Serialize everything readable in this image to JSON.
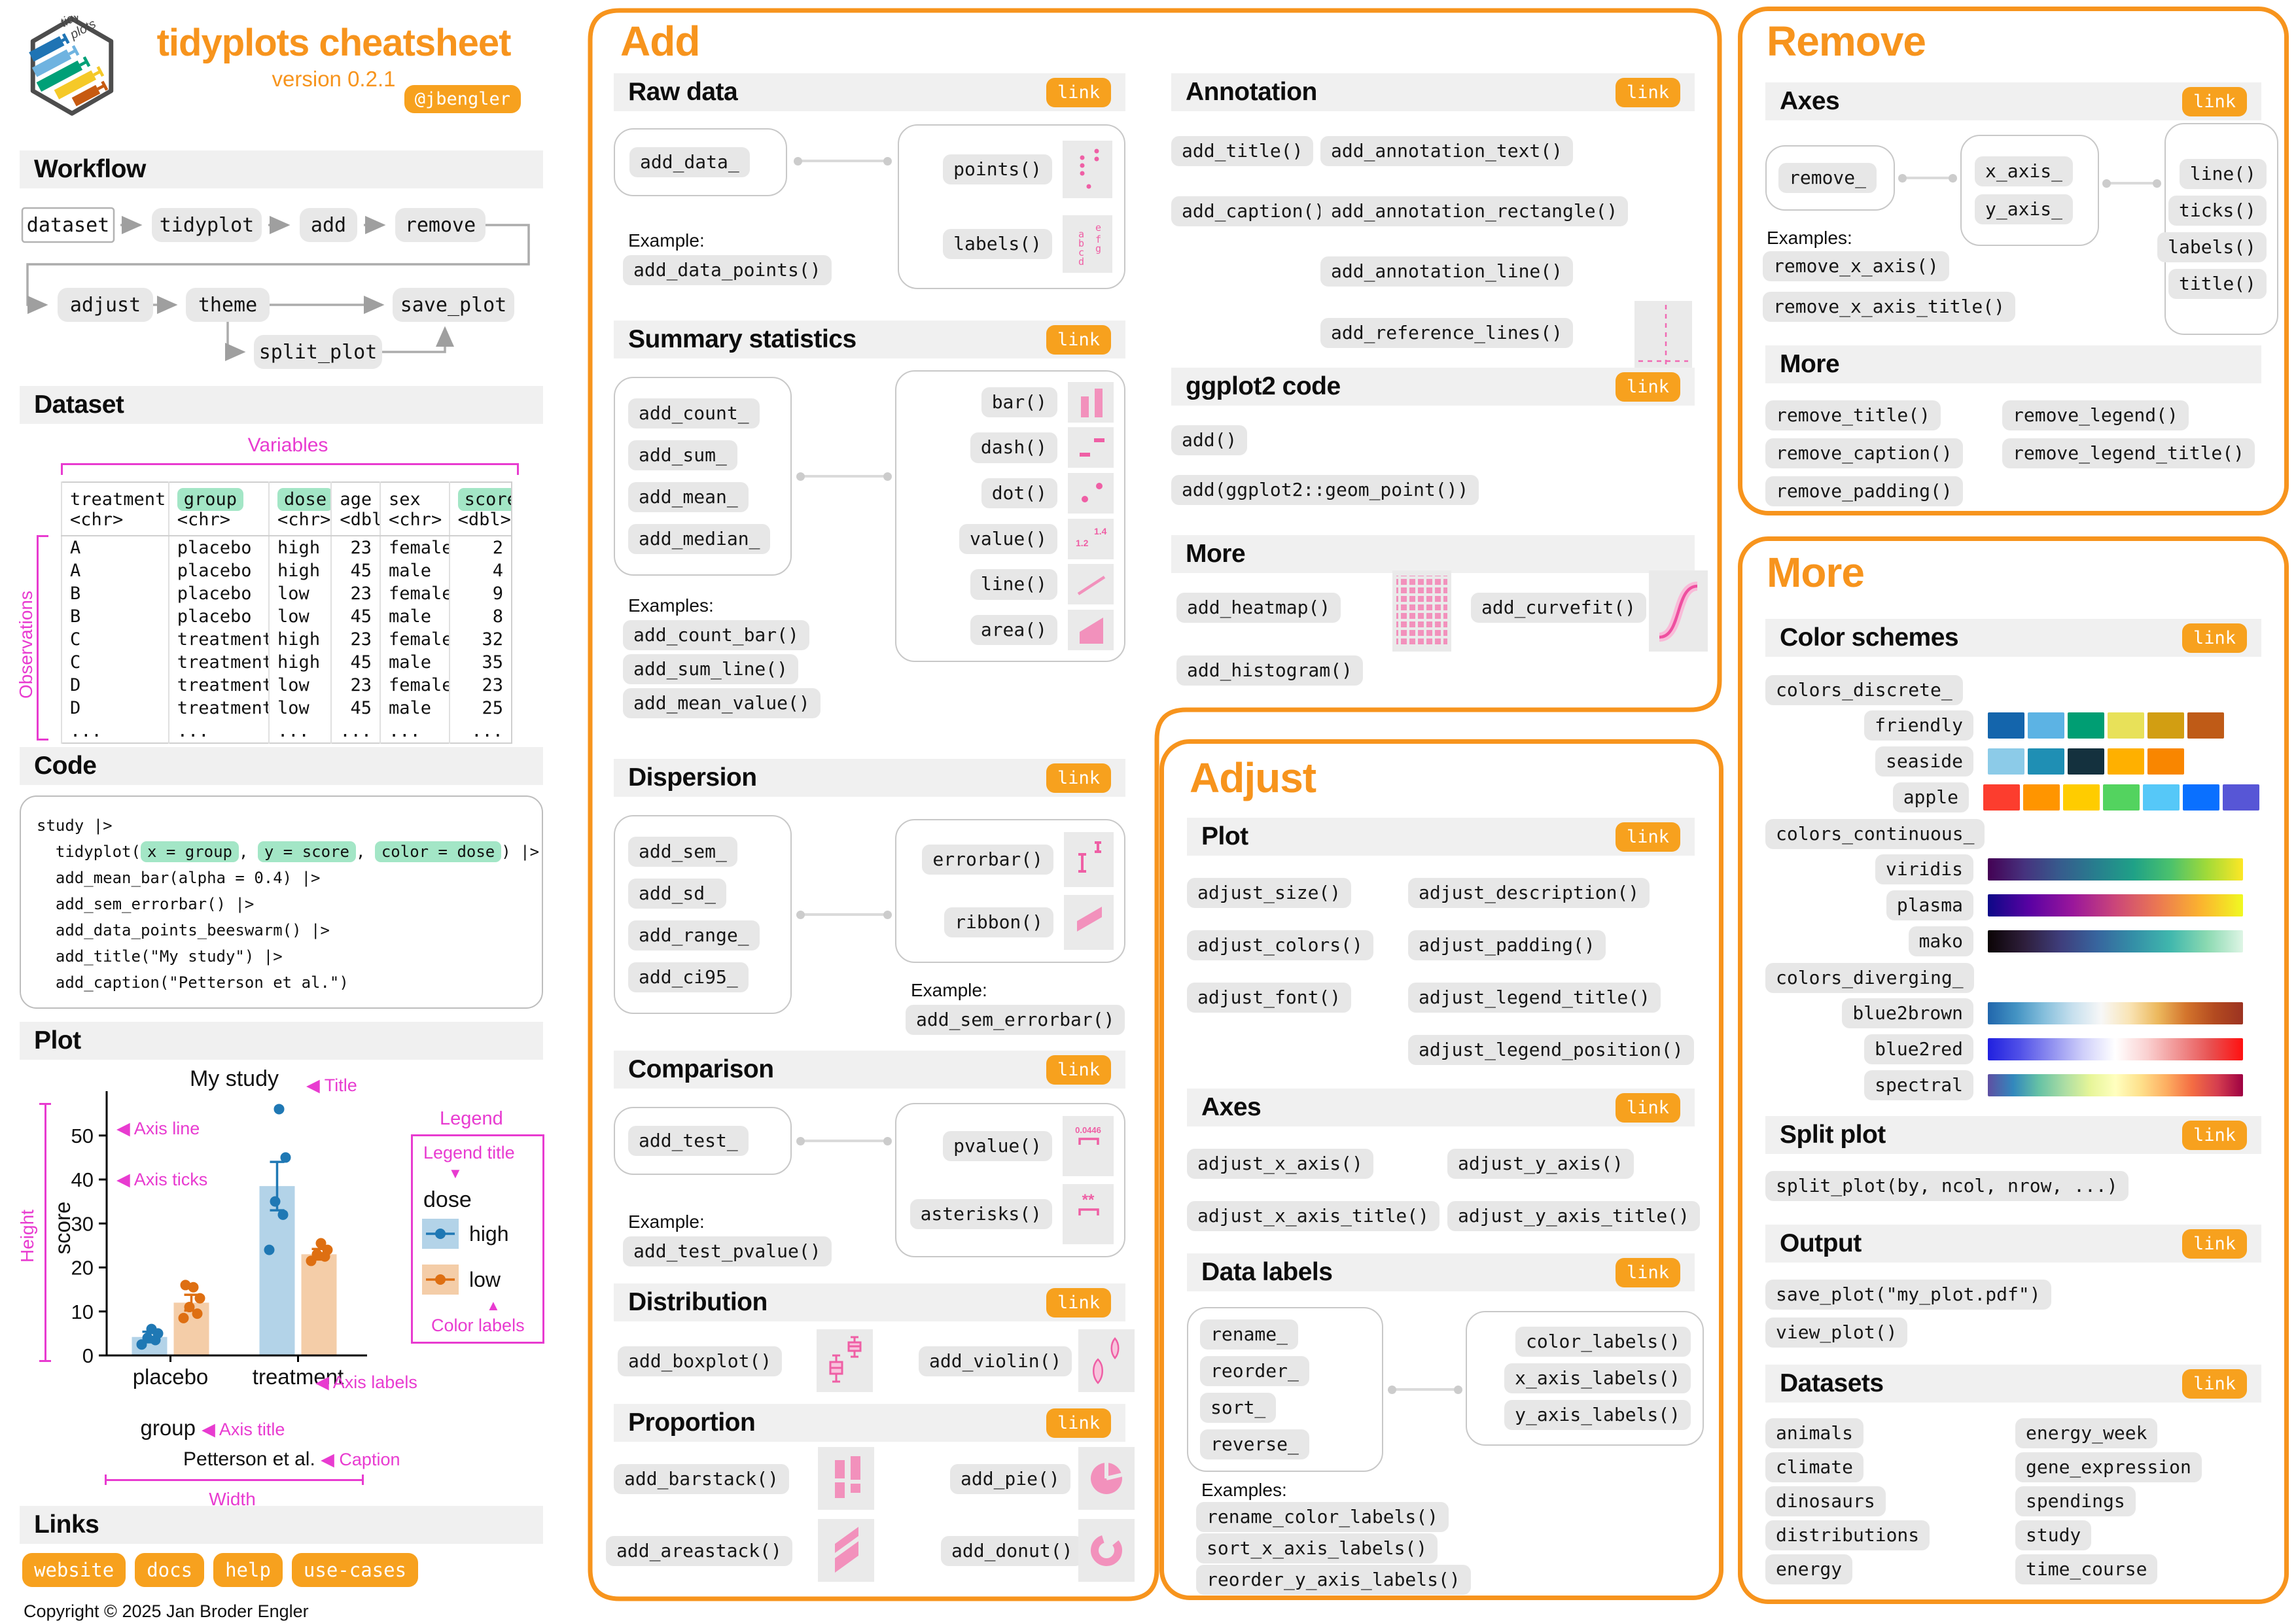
{
  "meta": {
    "title": "tidyplots cheatsheet",
    "version": "version 0.2.1",
    "handle": "@jbengler",
    "copyright": "Copyright © 2025 Jan Broder Engler",
    "link_label": "link",
    "logo_text1": "tidy",
    "logo_text2": "plots"
  },
  "colors": {
    "accent": "#F7941D",
    "magenta": "#E83BD0",
    "green_highlight": "#A3E6C6",
    "pink": "#F291BC"
  },
  "left": {
    "workflow": {
      "title": "Workflow",
      "nodes": [
        "dataset",
        "tidyplot",
        "add",
        "remove",
        "adjust",
        "theme",
        "save_plot",
        "split_plot"
      ]
    },
    "dataset": {
      "title": "Dataset",
      "variables": "Variables",
      "observations": "Observations",
      "columns": [
        {
          "n": "treatment",
          "t": "<chr>"
        },
        {
          "n": "group",
          "t": "<chr>",
          "hl": true
        },
        {
          "n": "dose",
          "t": "<chr>",
          "hl": true
        },
        {
          "n": "age",
          "t": "<dbl>",
          "num": true
        },
        {
          "n": "sex",
          "t": "<chr>"
        },
        {
          "n": "score",
          "t": "<dbl>",
          "hl": true,
          "num": true
        }
      ],
      "rows": [
        [
          "A",
          "placebo",
          "high",
          "23",
          "female",
          "2"
        ],
        [
          "A",
          "placebo",
          "high",
          "45",
          "male",
          "4"
        ],
        [
          "B",
          "placebo",
          "low",
          "23",
          "female",
          "9"
        ],
        [
          "B",
          "placebo",
          "low",
          "45",
          "male",
          "8"
        ],
        [
          "C",
          "treatment",
          "high",
          "23",
          "female",
          "32"
        ],
        [
          "C",
          "treatment",
          "high",
          "45",
          "male",
          "35"
        ],
        [
          "D",
          "treatment",
          "low",
          "23",
          "female",
          "23"
        ],
        [
          "D",
          "treatment",
          "low",
          "45",
          "male",
          "25"
        ],
        [
          "...",
          "...",
          "...",
          "...",
          "...",
          "..."
        ]
      ]
    },
    "code": {
      "title": "Code",
      "lines": [
        [
          {
            "t": "study |>"
          }
        ],
        [
          {
            "t": "  tidyplot("
          },
          {
            "t": "x = group",
            "hl": true
          },
          {
            "t": ", "
          },
          {
            "t": "y = score",
            "hl": true
          },
          {
            "t": ", "
          },
          {
            "t": "color = dose",
            "hl": true
          },
          {
            "t": ") |>"
          }
        ],
        [
          {
            "t": "  add_mean_bar(alpha = 0.4) |>"
          }
        ],
        [
          {
            "t": "  add_sem_errorbar() |>"
          }
        ],
        [
          {
            "t": "  add_data_points_beeswarm() |>"
          }
        ],
        [
          {
            "t": "  add_title(\"My study\") |>"
          }
        ],
        [
          {
            "t": "  add_caption(\"Petterson et al.\")"
          }
        ]
      ]
    },
    "plot": {
      "title": "Plot",
      "an": {
        "title_note": "Title",
        "axis_line": "Axis line",
        "axis_ticks": "Axis ticks",
        "height": "Height",
        "width": "Width",
        "legend": "Legend",
        "legend_title": "Legend title",
        "color_labels": "Color labels",
        "axis_labels": "Axis labels",
        "axis_title": "Axis title",
        "caption_note": "Caption"
      },
      "legend": {
        "entries": [
          "high",
          "low"
        ]
      }
    },
    "links": {
      "title": "Links",
      "items": [
        "website",
        "docs",
        "help",
        "use-cases"
      ]
    }
  },
  "chart_data": {
    "type": "bar",
    "title": "My study",
    "xlabel": "group",
    "ylabel": "score",
    "caption": "Petterson et al.",
    "categories": [
      "placebo",
      "treatment"
    ],
    "yticks": [
      0,
      10,
      20,
      30,
      40,
      50
    ],
    "ylim": [
      0,
      58
    ],
    "legend_title": "dose",
    "legend_position": "right",
    "grid": false,
    "series": [
      {
        "name": "high",
        "color": "#1F78B4",
        "bar_color": "#B3D3E8",
        "values": [
          4.2,
          38.5
        ],
        "sem": [
          1.2,
          5.5
        ],
        "points": [
          [
            2.5,
            3.5,
            4,
            5,
            6
          ],
          [
            24,
            32,
            35,
            45,
            56
          ]
        ]
      },
      {
        "name": "low",
        "color": "#DE6F12",
        "bar_color": "#F4CDA8",
        "values": [
          12,
          23
        ],
        "sem": [
          1.8,
          1.2
        ],
        "points": [
          [
            8.5,
            9.5,
            11,
            13,
            15.5,
            16
          ],
          [
            21.5,
            22.5,
            23,
            24,
            25.5
          ]
        ]
      }
    ]
  },
  "add": {
    "title": "Add",
    "sections": {
      "raw": {
        "title": "Raw data",
        "source": "add_data_",
        "targets": [
          "points()",
          "labels()"
        ],
        "example_label": "Example:",
        "example": "add_data_points()"
      },
      "summary": {
        "title": "Summary statistics",
        "sources": [
          "add_count_",
          "add_sum_",
          "add_mean_",
          "add_median_"
        ],
        "targets": [
          "bar()",
          "dash()",
          "dot()",
          "value()",
          "line()",
          "area()"
        ],
        "examples_label": "Examples:",
        "examples": [
          "add_count_bar()",
          "add_sum_line()",
          "add_mean_value()"
        ]
      },
      "dispersion": {
        "title": "Dispersion",
        "sources": [
          "add_sem_",
          "add_sd_",
          "add_range_",
          "add_ci95_"
        ],
        "targets": [
          "errorbar()",
          "ribbon()"
        ],
        "example_label": "Example:",
        "example": "add_sem_errorbar()"
      },
      "comparison": {
        "title": "Comparison",
        "source": "add_test_",
        "targets": [
          "pvalue()",
          "asterisks()"
        ],
        "example_label": "Example:",
        "example": "add_test_pvalue()",
        "pvalue_icon_text": "0.0446",
        "asterisks_icon_text": "**"
      },
      "distribution": {
        "title": "Distribution",
        "items": [
          "add_boxplot()",
          "add_violin()"
        ]
      },
      "proportion": {
        "title": "Proportion",
        "items": [
          "add_barstack()",
          "add_pie()",
          "add_areastack()",
          "add_donut()"
        ]
      },
      "annotation": {
        "title": "Annotation",
        "pills": [
          "add_title()",
          "add_annotation_text()",
          "add_caption()",
          "add_annotation_rectangle()",
          "add_annotation_line()",
          "add_reference_lines()"
        ]
      },
      "ggplot2": {
        "title": "ggplot2 code",
        "pills": [
          "add()",
          "add(ggplot2::geom_point())"
        ]
      },
      "more": {
        "title": "More",
        "pills": [
          "add_heatmap()",
          "add_curvefit()",
          "add_histogram()"
        ]
      }
    }
  },
  "adjust": {
    "title": "Adjust",
    "plot": {
      "title": "Plot",
      "col1": [
        "adjust_size()",
        "adjust_colors()",
        "adjust_font()"
      ],
      "col2": [
        "adjust_description()",
        "adjust_padding()",
        "adjust_legend_title()",
        "adjust_legend_position()"
      ]
    },
    "axes": {
      "title": "Axes",
      "col1": [
        "adjust_x_axis()",
        "adjust_x_axis_title()"
      ],
      "col2": [
        "adjust_y_axis()",
        "adjust_y_axis_title()"
      ]
    },
    "datalabels": {
      "title": "Data labels",
      "sources": [
        "rename_",
        "reorder_",
        "sort_",
        "reverse_"
      ],
      "targets": [
        "color_labels()",
        "x_axis_labels()",
        "y_axis_labels()"
      ],
      "examples_label": "Examples:",
      "examples": [
        "rename_color_labels()",
        "sort_x_axis_labels()",
        "reorder_y_axis_labels()"
      ]
    }
  },
  "remove": {
    "title": "Remove",
    "axes": {
      "title": "Axes",
      "source": "remove_",
      "mid": [
        "x_axis_",
        "y_axis_"
      ],
      "targets": [
        "line()",
        "ticks()",
        "labels()",
        "title()"
      ],
      "examples_label": "Examples:",
      "examples": [
        "remove_x_axis()",
        "remove_x_axis_title()"
      ]
    },
    "more": {
      "title": "More",
      "col1": [
        "remove_title()",
        "remove_caption()",
        "remove_padding()"
      ],
      "col2": [
        "remove_legend()",
        "remove_legend_title()"
      ]
    }
  },
  "more_panel": {
    "title": "More",
    "colors": {
      "title": "Color schemes",
      "discrete_label": "colors_discrete_",
      "continuous_label": "colors_continuous_",
      "diverging_label": "colors_diverging_",
      "discrete": [
        {
          "label": "friendly",
          "colors": [
            "#1465AC",
            "#5CB3E4",
            "#009E73",
            "#E8E159",
            "#D29E12",
            "#BF5B17"
          ]
        },
        {
          "label": "seaside",
          "colors": [
            "#8CCBE8",
            "#1F8FB4",
            "#14313E",
            "#FFB000",
            "#F98600"
          ]
        },
        {
          "label": "apple",
          "colors": [
            "#FC3D2E",
            "#FF9500",
            "#FFCC00",
            "#53D35F",
            "#56C8F8",
            "#0A70FF",
            "#5756D6"
          ]
        }
      ],
      "continuous": [
        {
          "label": "viridis",
          "colors": [
            "#440154",
            "#46327E",
            "#365C8D",
            "#277F8E",
            "#1FA187",
            "#4AC16D",
            "#A0DA39",
            "#FDE725"
          ]
        },
        {
          "label": "plasma",
          "colors": [
            "#0D0887",
            "#5B02A3",
            "#9A179B",
            "#CB4679",
            "#EB7852",
            "#FBB32F",
            "#F0F921"
          ]
        },
        {
          "label": "mako",
          "colors": [
            "#0B0405",
            "#2E1E3B",
            "#3F3E7C",
            "#37659E",
            "#348FA7",
            "#40B7AD",
            "#8AD9B1",
            "#DEF5E5"
          ]
        }
      ],
      "diverging": [
        {
          "label": "blue2brown",
          "colors": [
            "#2166AC",
            "#4393C3",
            "#86BFDC",
            "#C7E0EE",
            "#F7F7F7",
            "#F9E4B5",
            "#ECB85D",
            "#D3742C",
            "#B34A20",
            "#9C3321"
          ]
        },
        {
          "label": "blue2red",
          "colors": [
            "#2020DF",
            "#5050E8",
            "#9090F0",
            "#D0D0FA",
            "#FFFFFF",
            "#FAD0D0",
            "#F09090",
            "#E85050",
            "#FF1010"
          ]
        },
        {
          "label": "spectral",
          "colors": [
            "#5E4FA2",
            "#3288BD",
            "#66C2A5",
            "#ABDDA4",
            "#E6F598",
            "#FFFFBF",
            "#FEE08B",
            "#FDAE61",
            "#F46D43",
            "#D53E4F",
            "#9E0142"
          ]
        }
      ]
    },
    "split": {
      "title": "Split plot",
      "pill": "split_plot(by, ncol, nrow, ...)"
    },
    "output": {
      "title": "Output",
      "pills": [
        "save_plot(\"my_plot.pdf\")",
        "view_plot()"
      ]
    },
    "datasets": {
      "title": "Datasets",
      "col1": [
        "animals",
        "climate",
        "dinosaurs",
        "distributions",
        "energy"
      ],
      "col2": [
        "energy_week",
        "gene_expression",
        "spendings",
        "study",
        "time_course"
      ]
    }
  }
}
